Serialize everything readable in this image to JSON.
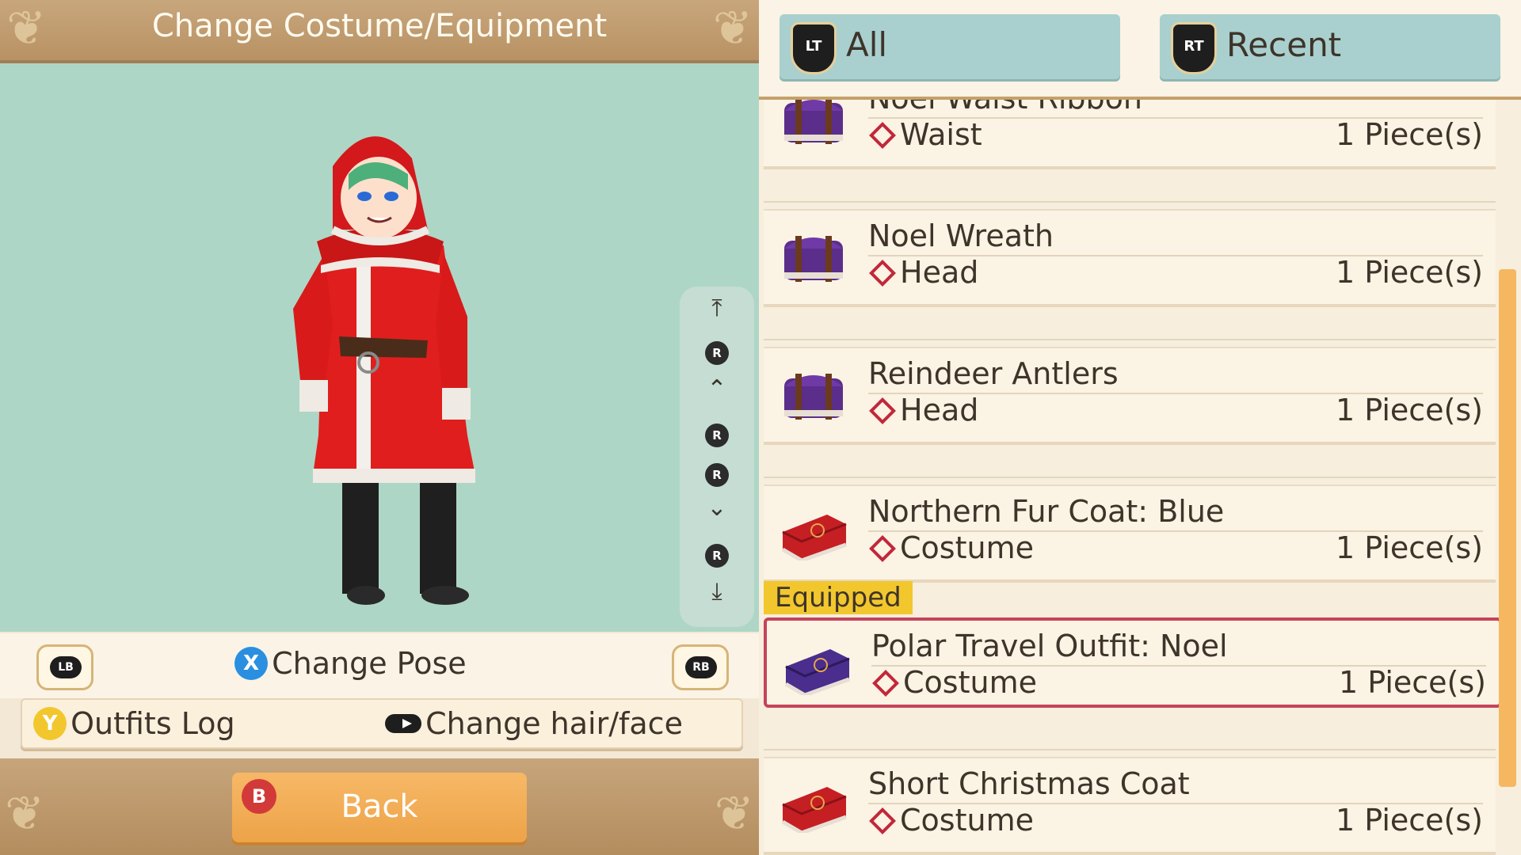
{
  "header": {
    "title": "Change Costume/Equipment"
  },
  "camera_controls": {
    "r_label": "R"
  },
  "controls": {
    "lb": "LB",
    "rb": "RB",
    "x_glyph": "X",
    "change_pose": "Change Pose",
    "y_glyph": "Y",
    "outfits_log": "Outfits Log",
    "change_hair_face": "Change hair/face"
  },
  "back": {
    "b_glyph": "B",
    "label": "Back"
  },
  "tabs": [
    {
      "glyph": "LT",
      "label": "All"
    },
    {
      "glyph": "RT",
      "label": "Recent"
    }
  ],
  "items": [
    {
      "name": "Noel Waist Ribbon",
      "slot": "Waist",
      "qty": "1 Piece(s)",
      "chest": "purple"
    },
    {
      "name": "Noel Wreath",
      "slot": "Head",
      "qty": "1 Piece(s)",
      "chest": "purple"
    },
    {
      "name": "Reindeer Antlers",
      "slot": "Head",
      "qty": "1 Piece(s)",
      "chest": "purple"
    },
    {
      "name": "Northern Fur Coat: Blue",
      "slot": "Costume",
      "qty": "1 Piece(s)",
      "chest": "red"
    },
    {
      "name": "Polar Travel Outfit: Noel",
      "slot": "Costume",
      "qty": "1 Piece(s)",
      "chest": "purple"
    },
    {
      "name": "Short Christmas Coat",
      "slot": "Costume",
      "qty": "1 Piece(s)",
      "chest": "red"
    }
  ],
  "equipped_label": "Equipped",
  "colors": {
    "accent": "#c4445c",
    "tab": "#a9d0ce",
    "viewport": "#aed6c6",
    "back": "#eda348"
  }
}
